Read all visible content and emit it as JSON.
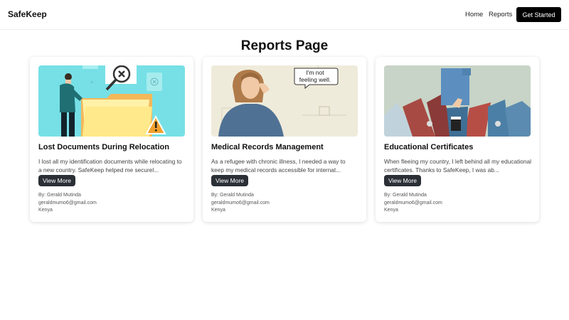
{
  "header": {
    "brand": "SafeKeep",
    "nav": {
      "home": "Home",
      "reports": "Reports"
    },
    "cta": "Get Started"
  },
  "page": {
    "title": "Reports Page"
  },
  "reports": [
    {
      "title": "Lost Documents During Relocation",
      "excerpt": "I lost all my identification documents while relocating to a new country. SafeKeep helped me securel...",
      "button": "View More",
      "author": "By: Gerald Mutinda",
      "email": "geraldmumo6@gmail.com",
      "country": "Kenya",
      "image": "lost-documents-illustration"
    },
    {
      "title": "Medical Records Management",
      "excerpt": "As a refugee with chronic illness, I needed a way to keep my medical records accessible for internat...",
      "button": "View More",
      "author": "By: Gerald Mutinda",
      "email": "geraldmumo6@gmail.com",
      "country": "Kenya",
      "image": "unwell-woman-illustration",
      "speech_bubble": [
        "I'm not",
        "feeling well."
      ]
    },
    {
      "title": "Educational Certificates",
      "excerpt": "When fleeing my country, I left behind all my educational certificates. Thanks to SafeKeep, I was ab...",
      "button": "View More",
      "author": "By: Gerald Mutinda",
      "email": "geraldmumo6@gmail.com",
      "country": "Kenya",
      "image": "binders-and-folder-photo"
    }
  ]
}
